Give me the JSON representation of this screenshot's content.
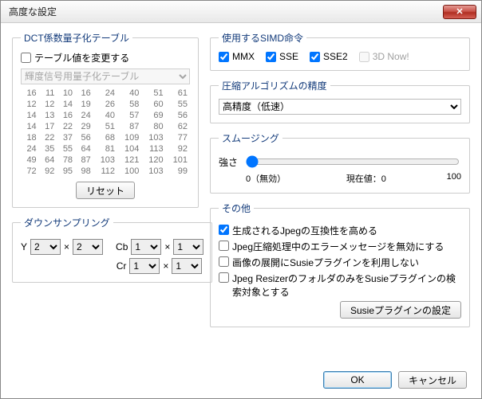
{
  "window": {
    "title": "高度な設定",
    "close": "✕"
  },
  "dct": {
    "legend": "DCT係数量子化テーブル",
    "modify_label": "テーブル値を変更する",
    "modify_checked": false,
    "table_select": "輝度信号用量子化テーブル",
    "values": [
      [
        16,
        11,
        10,
        16,
        24,
        40,
        51,
        61
      ],
      [
        12,
        12,
        14,
        19,
        26,
        58,
        60,
        55
      ],
      [
        14,
        13,
        16,
        24,
        40,
        57,
        69,
        56
      ],
      [
        14,
        17,
        22,
        29,
        51,
        87,
        80,
        62
      ],
      [
        18,
        22,
        37,
        56,
        68,
        109,
        103,
        77
      ],
      [
        24,
        35,
        55,
        64,
        81,
        104,
        113,
        92
      ],
      [
        49,
        64,
        78,
        87,
        103,
        121,
        120,
        101
      ],
      [
        72,
        92,
        95,
        98,
        112,
        100,
        103,
        99
      ]
    ],
    "reset": "リセット"
  },
  "downsample": {
    "legend": "ダウンサンプリング",
    "y_label": "Y",
    "cb_label": "Cb",
    "cr_label": "Cr",
    "x": "×",
    "y_h": "2",
    "y_v": "2",
    "cb_h": "1",
    "cb_v": "1",
    "cr_h": "1",
    "cr_v": "1"
  },
  "simd": {
    "legend": "使用するSIMD命令",
    "mmx": "MMX",
    "sse": "SSE",
    "sse2": "SSE2",
    "threednow": "3D Now!",
    "mmx_checked": true,
    "sse_checked": true,
    "sse2_checked": true,
    "threednow_checked": false,
    "threednow_enabled": false
  },
  "compress": {
    "legend": "圧縮アルゴリズムの精度",
    "value": "高精度（低速）"
  },
  "smoothing": {
    "legend": "スムージング",
    "strength_label": "強さ",
    "zero_label": "0（無効）",
    "current_label": "現在値：0",
    "max_label": "100",
    "value": 0
  },
  "other": {
    "legend": "その他",
    "opt1": "生成されるJpegの互換性を高める",
    "opt2": "Jpeg圧縮処理中のエラーメッセージを無効にする",
    "opt3": "画像の展開にSusieプラグインを利用しない",
    "opt4": "Jpeg ResizerのフォルダのみをSusieプラグインの検索対象とする",
    "opt1_checked": true,
    "opt2_checked": false,
    "opt3_checked": false,
    "opt4_checked": false,
    "susie_btn": "Susieプラグインの設定"
  },
  "footer": {
    "ok": "OK",
    "cancel": "キャンセル"
  }
}
